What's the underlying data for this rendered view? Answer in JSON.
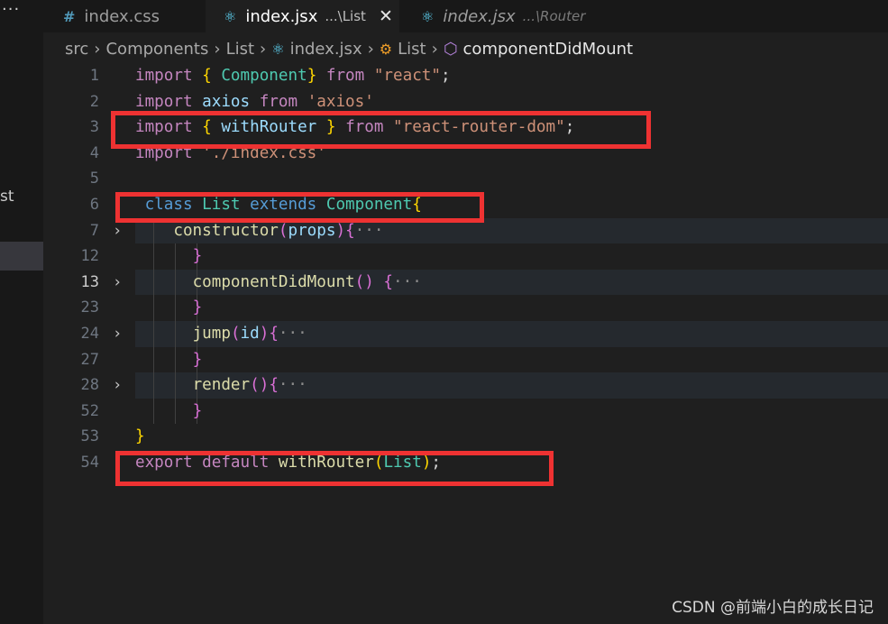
{
  "tabs": [
    {
      "icon": "#",
      "name": "index.css",
      "desc": ""
    },
    {
      "icon": "⚛",
      "name": "index.jsx",
      "desc": "...\\List",
      "close": "✕"
    },
    {
      "icon": "⚛",
      "name": "index.jsx",
      "desc": "...\\Router"
    }
  ],
  "side": {
    "dots": "···",
    "cut_text": "st"
  },
  "breadcrumb": {
    "items": [
      "src",
      "Components",
      "List",
      "index.jsx",
      "List",
      "componentDidMount"
    ],
    "sep": "›"
  },
  "lines": [
    {
      "n": "1",
      "fold": "",
      "tokens": [
        [
          "kw",
          "import"
        ],
        [
          "pun",
          " "
        ],
        [
          "b1",
          "{"
        ],
        [
          "pun",
          " "
        ],
        [
          "cls",
          "Component"
        ],
        [
          "b1",
          "}"
        ],
        [
          "pun",
          " "
        ],
        [
          "kw",
          "from"
        ],
        [
          "pun",
          " "
        ],
        [
          "str",
          "\"react\""
        ],
        [
          "pun",
          ";"
        ]
      ]
    },
    {
      "n": "2",
      "fold": "",
      "tokens": [
        [
          "kw",
          "import"
        ],
        [
          "pun",
          " "
        ],
        [
          "var",
          "axios"
        ],
        [
          "pun",
          " "
        ],
        [
          "kw",
          "from"
        ],
        [
          "pun",
          " "
        ],
        [
          "str",
          "'axios'"
        ]
      ]
    },
    {
      "n": "3",
      "fold": "",
      "tokens": [
        [
          "kw",
          "import"
        ],
        [
          "pun",
          " "
        ],
        [
          "b1",
          "{"
        ],
        [
          "pun",
          " "
        ],
        [
          "var",
          "withRouter"
        ],
        [
          "pun",
          " "
        ],
        [
          "b1",
          "}"
        ],
        [
          "pun",
          " "
        ],
        [
          "kw",
          "from"
        ],
        [
          "pun",
          " "
        ],
        [
          "str",
          "\"react-router-dom\""
        ],
        [
          "pun",
          ";"
        ]
      ]
    },
    {
      "n": "4",
      "fold": "",
      "tokens": [
        [
          "kw",
          "import"
        ],
        [
          "pun",
          " "
        ],
        [
          "str",
          "'./index.css'"
        ]
      ]
    },
    {
      "n": "5",
      "fold": "",
      "tokens": []
    },
    {
      "n": "6",
      "fold": "",
      "tokens": [
        [
          "pun",
          " "
        ],
        [
          "bk",
          "class"
        ],
        [
          "pun",
          " "
        ],
        [
          "cls",
          "List"
        ],
        [
          "pun",
          " "
        ],
        [
          "bk",
          "extends"
        ],
        [
          "pun",
          " "
        ],
        [
          "cls",
          "Component"
        ],
        [
          "b1",
          "{"
        ]
      ]
    },
    {
      "n": "7",
      "fold": "›",
      "tokens": [
        [
          "pun",
          "    "
        ],
        [
          "fn",
          "constructor"
        ],
        [
          "b2",
          "("
        ],
        [
          "var",
          "props"
        ],
        [
          "b2",
          ")"
        ],
        [
          "b2",
          "{"
        ],
        [
          "ell",
          "···"
        ]
      ]
    },
    {
      "n": "12",
      "fold": "",
      "tokens": [
        [
          "pun",
          "      "
        ],
        [
          "b2",
          "}"
        ]
      ]
    },
    {
      "n": "13",
      "fold": "›",
      "active": true,
      "tokens": [
        [
          "pun",
          "      "
        ],
        [
          "fn",
          "componentDidMount"
        ],
        [
          "b2",
          "()"
        ],
        [
          "pun",
          " "
        ],
        [
          "b2",
          "{"
        ],
        [
          "ell",
          "···"
        ]
      ]
    },
    {
      "n": "23",
      "fold": "",
      "tokens": [
        [
          "pun",
          "      "
        ],
        [
          "b2",
          "}"
        ]
      ]
    },
    {
      "n": "24",
      "fold": "›",
      "tokens": [
        [
          "pun",
          "      "
        ],
        [
          "fn",
          "jump"
        ],
        [
          "b2",
          "("
        ],
        [
          "var",
          "id"
        ],
        [
          "b2",
          ")"
        ],
        [
          "b2",
          "{"
        ],
        [
          "ell",
          "···"
        ]
      ]
    },
    {
      "n": "27",
      "fold": "",
      "tokens": [
        [
          "pun",
          "      "
        ],
        [
          "b2",
          "}"
        ]
      ]
    },
    {
      "n": "28",
      "fold": "›",
      "tokens": [
        [
          "pun",
          "      "
        ],
        [
          "fn",
          "render"
        ],
        [
          "b2",
          "()"
        ],
        [
          "b2",
          "{"
        ],
        [
          "ell",
          "···"
        ]
      ]
    },
    {
      "n": "52",
      "fold": "",
      "tokens": [
        [
          "pun",
          "      "
        ],
        [
          "b2",
          "}"
        ]
      ]
    },
    {
      "n": "53",
      "fold": "",
      "tokens": [
        [
          "b1",
          "}"
        ]
      ]
    },
    {
      "n": "54",
      "fold": "",
      "tokens": [
        [
          "kw",
          "export"
        ],
        [
          "pun",
          " "
        ],
        [
          "kw",
          "default"
        ],
        [
          "pun",
          " "
        ],
        [
          "fn",
          "withRouter"
        ],
        [
          "b1",
          "("
        ],
        [
          "cls",
          "List"
        ],
        [
          "b1",
          ")"
        ],
        [
          "pun",
          ";"
        ]
      ]
    }
  ],
  "watermark": "CSDN @前端小白的成长日记",
  "colors": {
    "annotation": "#ee3232",
    "editor_bg": "#1f1f1f"
  }
}
